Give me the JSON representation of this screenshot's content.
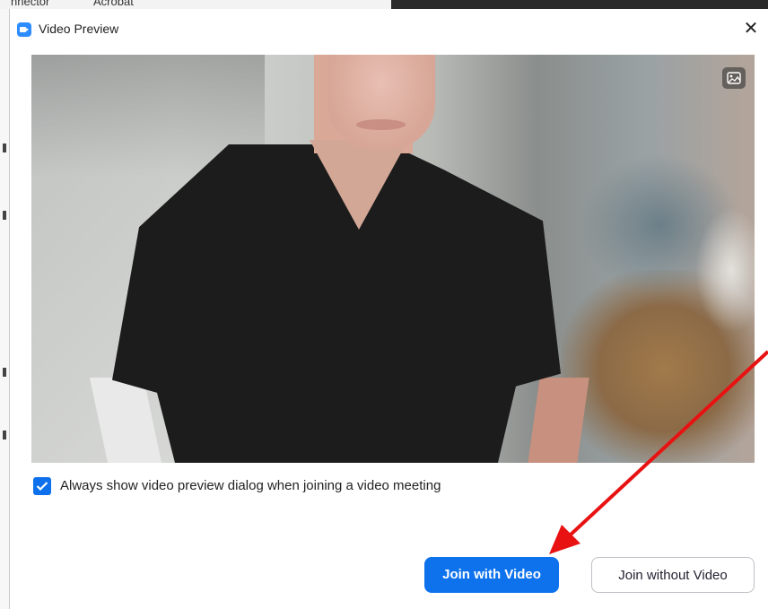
{
  "background_app": {
    "fragments": [
      "nnector",
      "Acrobat"
    ]
  },
  "dialog": {
    "title": "Video Preview",
    "icons": {
      "app": "zoom-camera-icon",
      "close": "close-icon",
      "photo": "image-icon",
      "check": "checkmark-icon"
    },
    "close_symbol": "✕",
    "video_preview": {
      "alt": "camera preview"
    },
    "checkbox": {
      "label": "Always show video preview dialog when joining a video meeting",
      "checked": true
    },
    "buttons": {
      "join_with_video": "Join with Video",
      "join_without_video": "Join without Video"
    }
  },
  "colors": {
    "accent": "#0e72ed",
    "annotation_arrow": "#e81212"
  }
}
